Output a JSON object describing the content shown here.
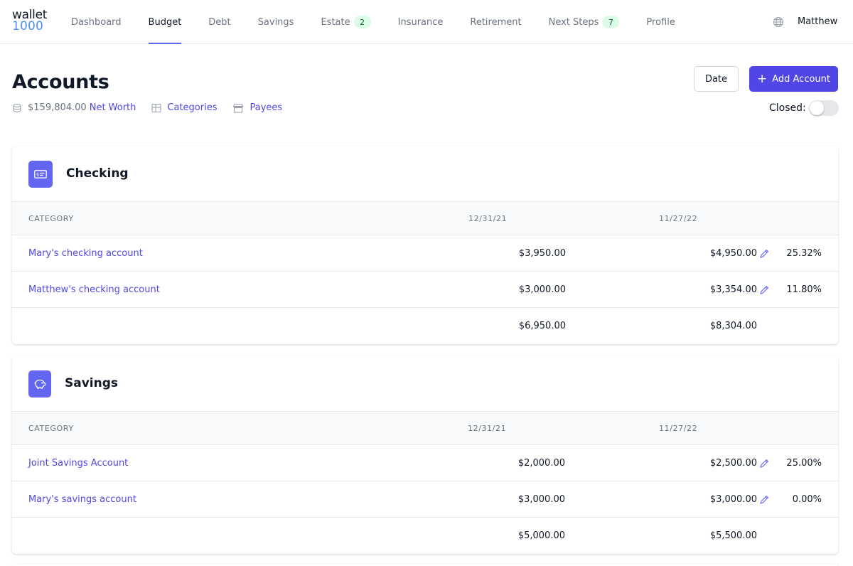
{
  "app": {
    "logo_line1": "wallet",
    "logo_line2": "1000"
  },
  "nav": {
    "items": [
      {
        "label": "Dashboard",
        "active": false
      },
      {
        "label": "Budget",
        "active": true
      },
      {
        "label": "Debt",
        "active": false
      },
      {
        "label": "Savings",
        "active": false
      },
      {
        "label": "Estate",
        "active": false,
        "badge": "2"
      },
      {
        "label": "Insurance",
        "active": false
      },
      {
        "label": "Retirement",
        "active": false
      },
      {
        "label": "Next Steps",
        "active": false,
        "badge": "7"
      },
      {
        "label": "Profile",
        "active": false
      }
    ],
    "user": "Matthew",
    "globe_icon": "globe-icon"
  },
  "page": {
    "title": "Accounts",
    "net_worth_value": "$159,804.00",
    "net_worth_label": "Net Worth",
    "categories_label": "Categories",
    "payees_label": "Payees",
    "date_button": "Date",
    "add_button": "Add Account",
    "closed_label": "Closed:",
    "closed_toggle_on": false
  },
  "colors": {
    "accent": "#4f46e5",
    "icon_bg": "#6366f1",
    "badge_bg": "#dcfce7"
  },
  "sections": [
    {
      "title": "Checking",
      "icon": "check-icon",
      "columns": {
        "category": "CATEGORY",
        "date1": "12/31/21",
        "date2": "11/27/22"
      },
      "rows": [
        {
          "name": "Mary's checking account",
          "prev": "$3,950.00",
          "curr": "$4,950.00",
          "pct": "25.32%"
        },
        {
          "name": "Matthew's checking account",
          "prev": "$3,000.00",
          "curr": "$3,354.00",
          "pct": "11.80%"
        }
      ],
      "totals": {
        "prev": "$6,950.00",
        "curr": "$8,304.00"
      }
    },
    {
      "title": "Savings",
      "icon": "piggy-bank-icon",
      "columns": {
        "category": "CATEGORY",
        "date1": "12/31/21",
        "date2": "11/27/22"
      },
      "rows": [
        {
          "name": "Joint Savings Account",
          "prev": "$2,000.00",
          "curr": "$2,500.00",
          "pct": "25.00%"
        },
        {
          "name": "Mary's savings account",
          "prev": "$3,000.00",
          "curr": "$3,000.00",
          "pct": "0.00%"
        }
      ],
      "totals": {
        "prev": "$5,000.00",
        "curr": "$5,500.00"
      }
    }
  ]
}
